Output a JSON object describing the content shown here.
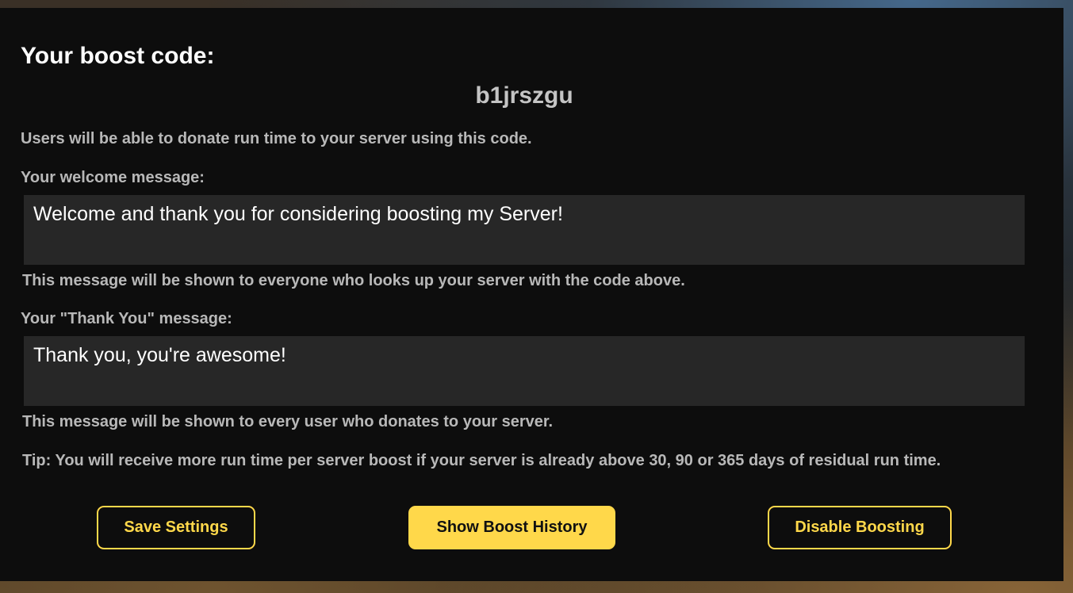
{
  "boost": {
    "title": "Your boost code:",
    "code": "b1jrszgu",
    "code_description": "Users will be able to donate run time to your server using this code."
  },
  "welcome": {
    "label": "Your welcome message:",
    "value": "Welcome and thank you for considering boosting my Server!",
    "help": "This message will be shown to everyone who looks up your server with the code above."
  },
  "thank_you": {
    "label": "Your \"Thank You\" message:",
    "value": "Thank you, you're awesome!",
    "help": "This message will be shown to every user who donates to your server."
  },
  "tip": "Tip: You will receive more run time per server boost if your server is already above 30, 90 or 365 days of residual run time.",
  "buttons": {
    "save": "Save Settings",
    "history": "Show Boost History",
    "disable": "Disable Boosting"
  },
  "colors": {
    "accent": "#ffd84a",
    "panel_bg": "#0d0d0d",
    "field_bg": "#272727"
  }
}
